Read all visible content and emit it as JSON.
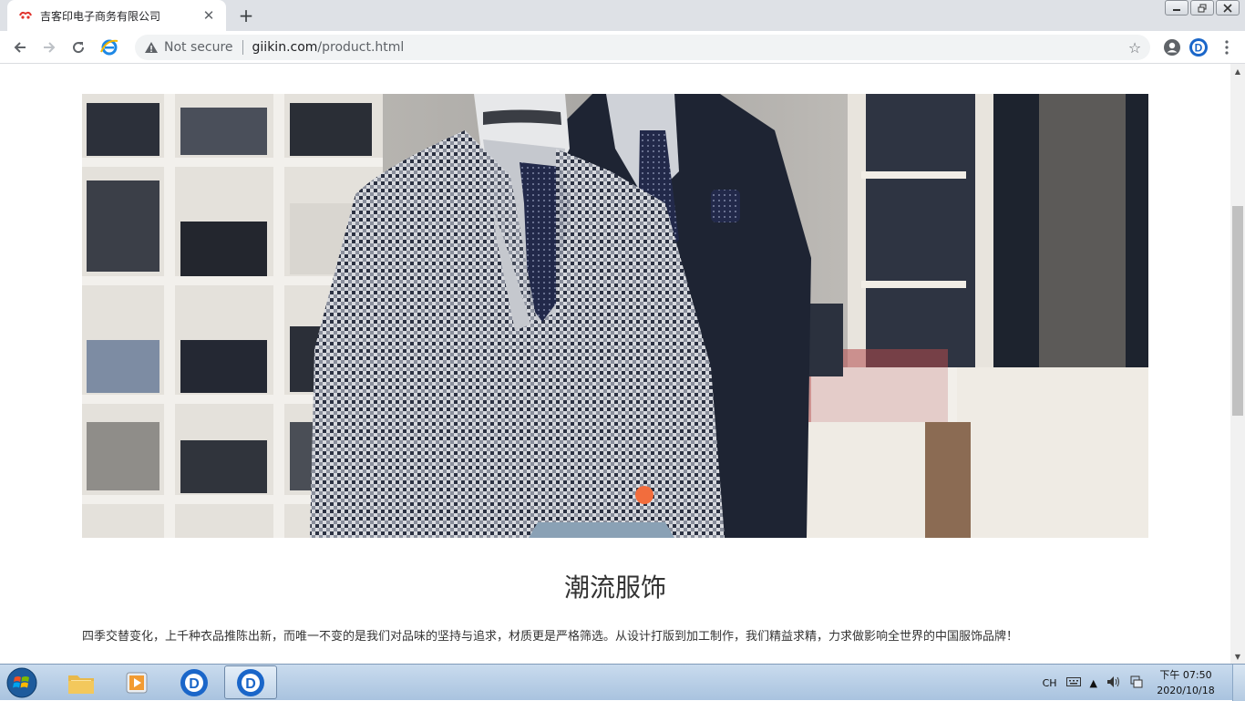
{
  "browser": {
    "tab": {
      "title": "吉客印电子商务有限公司",
      "favicon": "giikin-logo-icon"
    },
    "window_controls": {
      "minimize": "minimize-icon",
      "restore": "restore-icon",
      "close": "close-icon"
    },
    "address_bar": {
      "security_label": "Not secure",
      "url_host": "giikin.com",
      "url_path": "/product.html"
    }
  },
  "page": {
    "hero_image": "mannequins-in-checked-suit-and-navy-suit",
    "product_title": "潮流服饰",
    "product_description": "四季交替变化，上千种衣品推陈出新，而唯一不变的是我们对品味的坚持与追求，材质更是严格筛选。从设计打版到加工制作，我们精益求精，力求做影响全世界的中国服饰品牌！"
  },
  "taskbar": {
    "apps": [
      "file-explorer-icon",
      "media-player-icon",
      "dingtalk-icon",
      "dingtalk-icon"
    ],
    "ime_label": "CH",
    "clock_time": "下午 07:50",
    "clock_date": "2020/10/18"
  },
  "colors": {
    "tab_strip": "#dee1e6",
    "taskbar": "#b9cfe7",
    "accent_orange": "#f26d3d"
  }
}
